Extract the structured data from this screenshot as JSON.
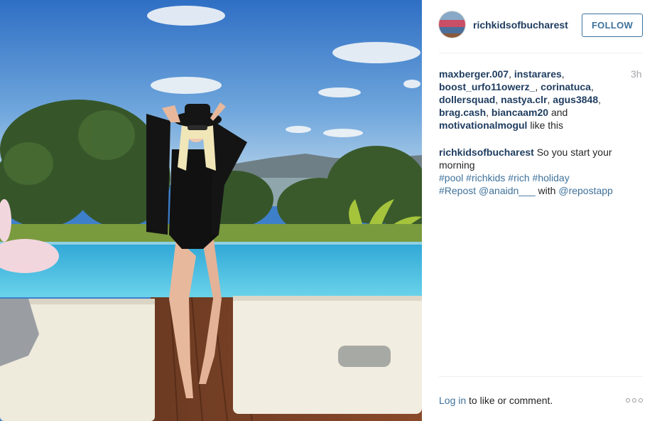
{
  "post": {
    "username": "richkidsofbucharest",
    "follow_label": "FOLLOW",
    "timestamp": "3h",
    "likes": {
      "users": [
        "maxberger.007",
        "instarares",
        "boost_urfo11owerz_",
        "corinatuca",
        "dollersquad",
        "nastya.clr",
        "agus3848",
        "brag.cash",
        "biancaam20",
        "motivationalmogul"
      ],
      "separator": ", ",
      "and_word": " and",
      "suffix": " like this"
    },
    "caption": {
      "author": "richkidsofbucharest",
      "text": " So you start your morning",
      "hashtags": [
        "#pool",
        "#richkids",
        "#rich",
        "#holiday",
        "#Repost"
      ],
      "mention_1": "@anaidn___",
      "with_word": " with ",
      "mention_2": "@repostapp"
    },
    "footer": {
      "login_link": "Log in",
      "login_suffix": " to like or comment."
    }
  },
  "colors": {
    "username": "#1e3c5f",
    "link": "#3f729b",
    "muted": "#a5a7aa"
  },
  "icons": {
    "more": "more-options-icon"
  }
}
